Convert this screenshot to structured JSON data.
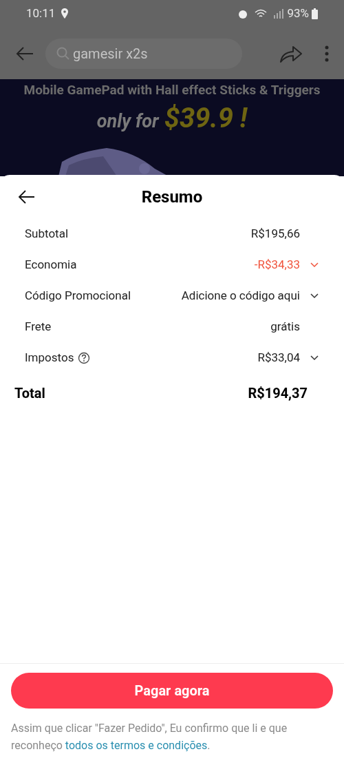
{
  "status_bar": {
    "time": "10:11",
    "battery": "93%"
  },
  "top_bar": {
    "search": {
      "value": "gamesir x2s"
    }
  },
  "banner": {
    "headline": "Mobile GamePad with Hall effect Sticks & Triggers",
    "offer": "only for",
    "price": "$39.9 !"
  },
  "sheet": {
    "title": "Resumo",
    "rows": [
      {
        "label": "Subtotal",
        "value": "R$195,66",
        "help": false,
        "expandable": false,
        "highlight": false
      },
      {
        "label": "Economia",
        "value": "-R$34,33",
        "help": false,
        "expandable": true,
        "highlight": true
      },
      {
        "label": "Código Promocional",
        "value": "Adicione o código aqui",
        "help": false,
        "expandable": true,
        "highlight": false
      },
      {
        "label": "Frete",
        "value": "grátis",
        "help": false,
        "expandable": false,
        "highlight": false
      },
      {
        "label": "Impostos",
        "value": "R$33,04",
        "help": true,
        "expandable": true,
        "highlight": false
      }
    ],
    "total": {
      "label": "Total",
      "value": "R$194,37"
    }
  },
  "footer": {
    "button": "Pagar agora",
    "notice": "Assim que clicar \"Fazer Pedido\", Eu confirmo que li e que reconheço",
    "link": "todos os termos e condições",
    "end": "."
  }
}
